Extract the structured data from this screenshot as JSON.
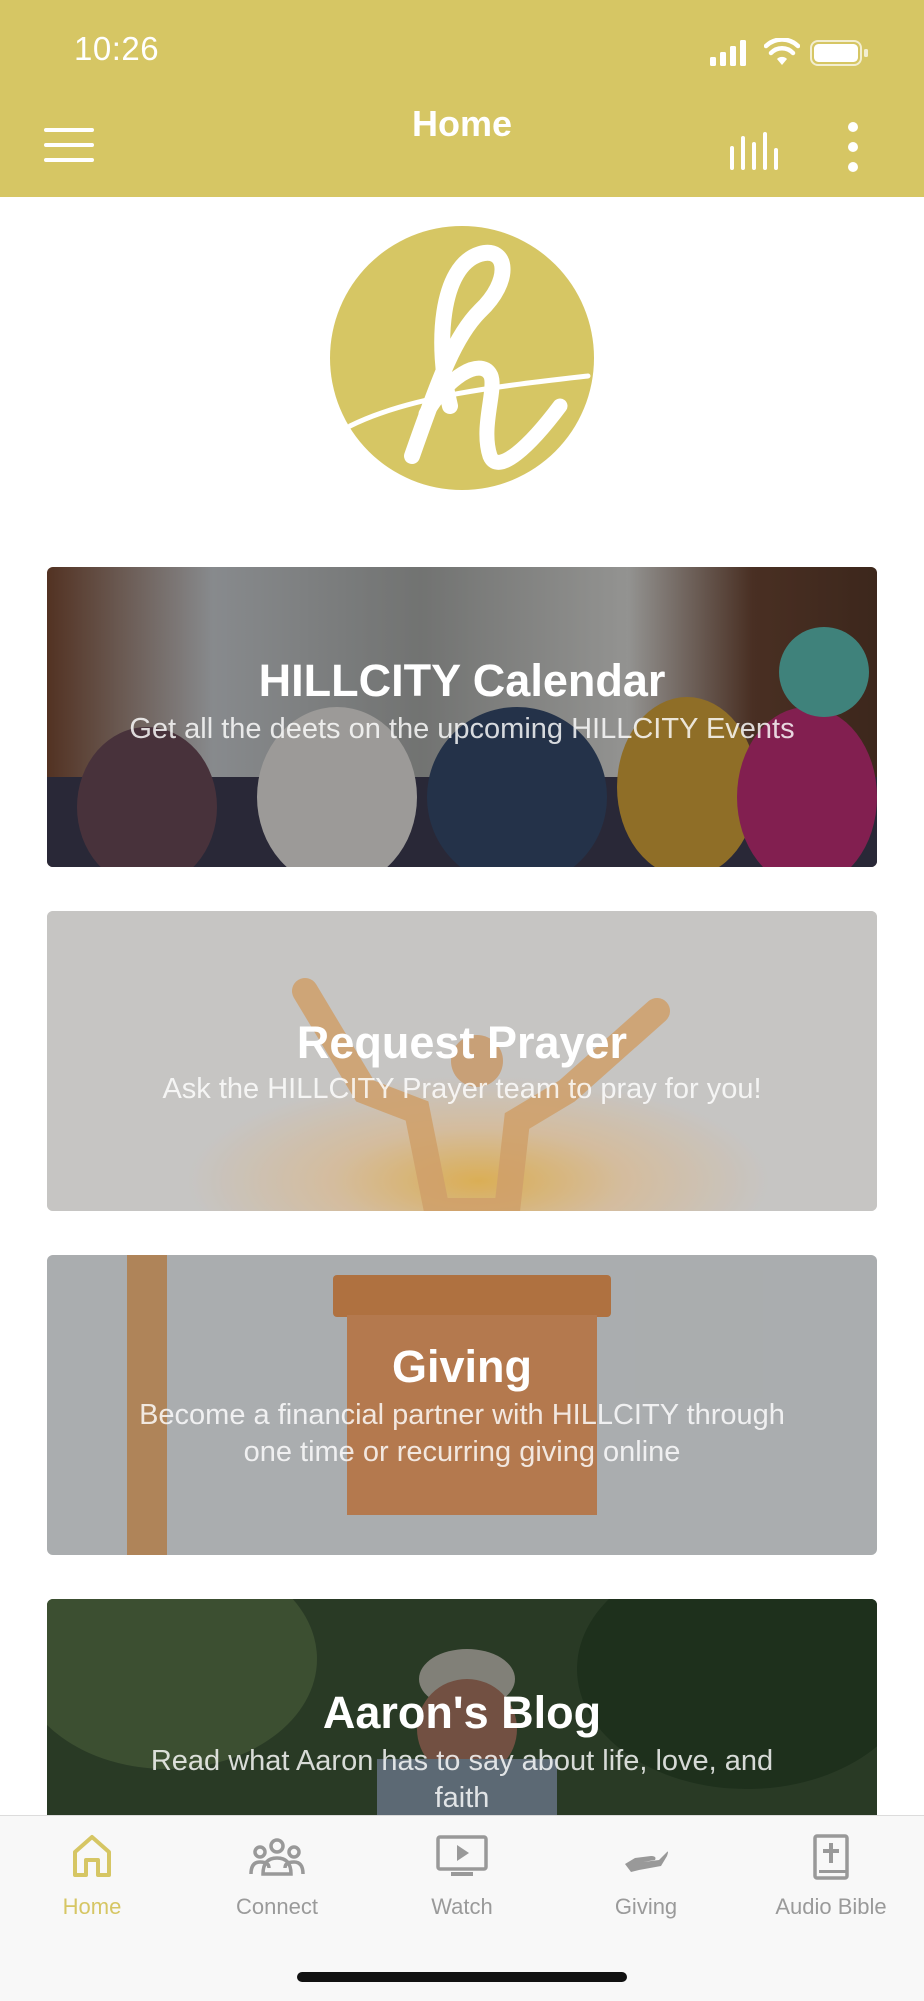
{
  "status_bar": {
    "time": "10:26"
  },
  "header": {
    "title": "Home",
    "accent_color": "#d6c664"
  },
  "icons": {
    "menu": "hamburger-menu-icon",
    "chart": "bar-chart-icon",
    "more": "more-vertical-icon"
  },
  "logo": {
    "letter": "h"
  },
  "cards": [
    {
      "title": "HILLCITY Calendar",
      "description": "Get all the deets on the upcoming HILLCITY Events"
    },
    {
      "title": "Request Prayer",
      "description": "Ask the HILLCITY Prayer team to pray for you!"
    },
    {
      "title": "Giving",
      "description": "Become a financial partner with HILLCITY through one time or recurring giving online"
    },
    {
      "title": "Aaron's Blog",
      "description": "Read what Aaron has to say about life, love, and faith"
    }
  ],
  "bottom_nav": {
    "items": [
      {
        "label": "Home",
        "icon": "home-icon",
        "active": true
      },
      {
        "label": "Connect",
        "icon": "people-icon",
        "active": false
      },
      {
        "label": "Watch",
        "icon": "video-icon",
        "active": false
      },
      {
        "label": "Giving",
        "icon": "giving-hand-icon",
        "active": false
      },
      {
        "label": "Audio Bible",
        "icon": "bible-icon",
        "active": false
      }
    ]
  }
}
